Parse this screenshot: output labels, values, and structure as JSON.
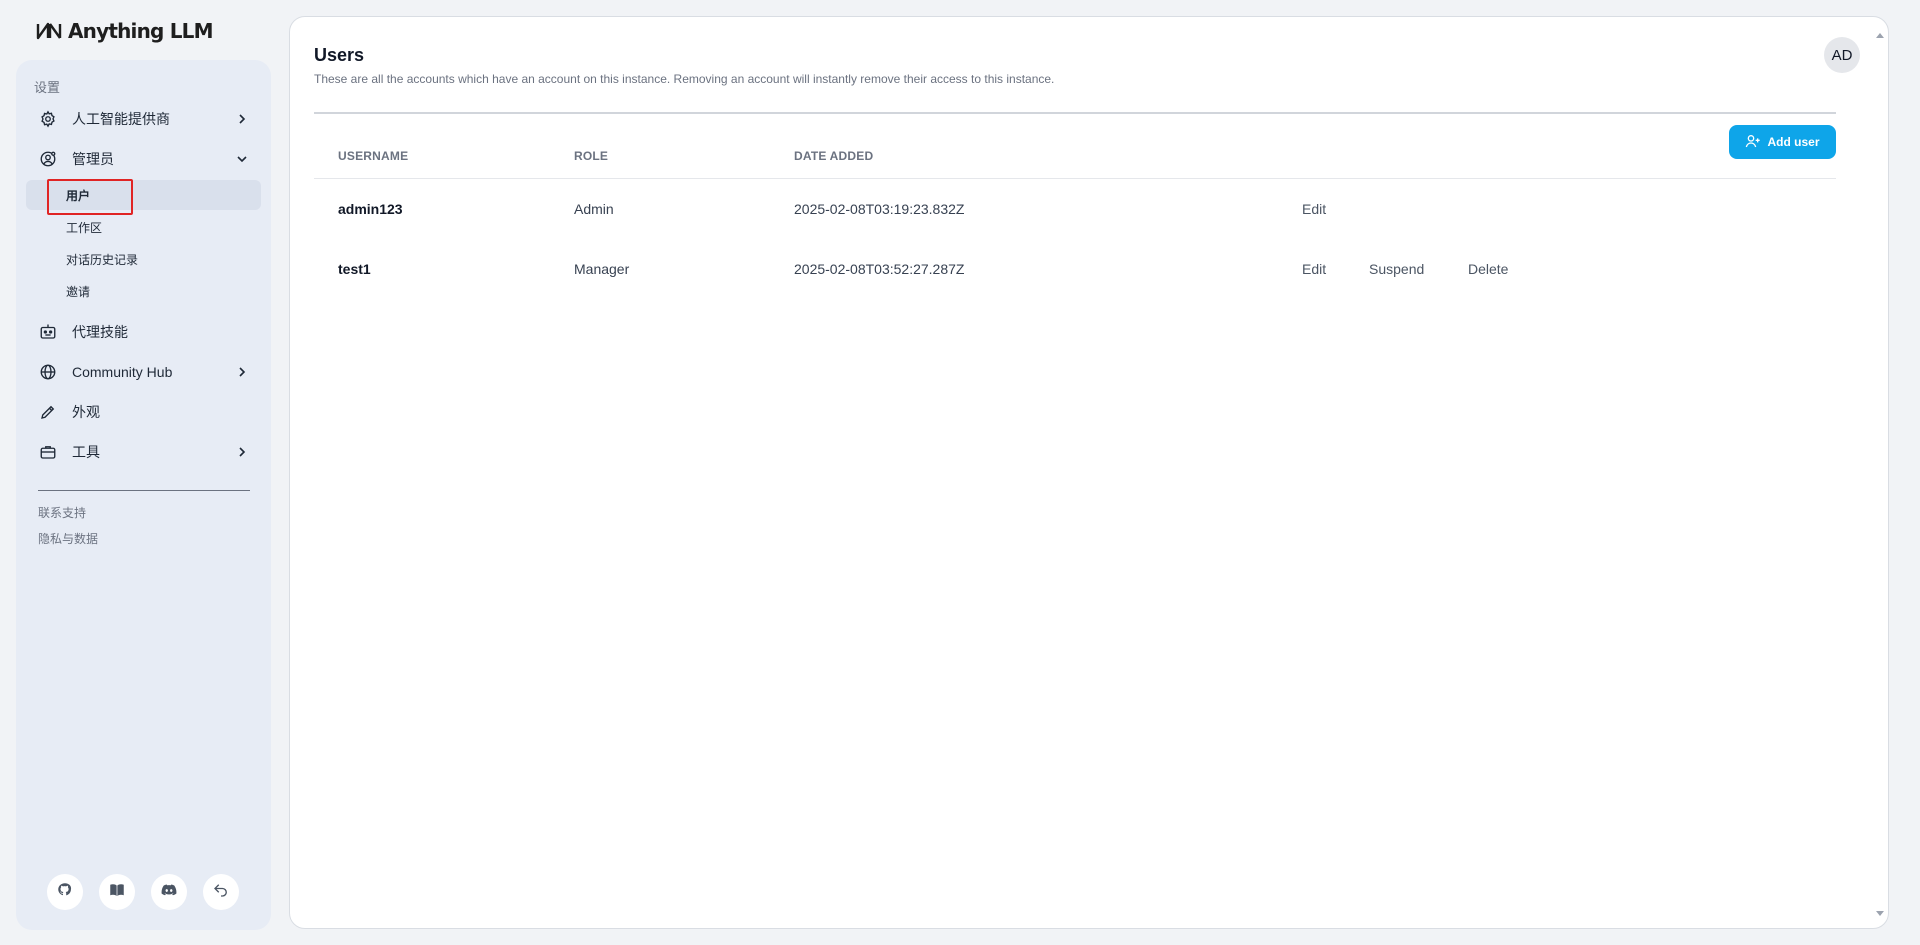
{
  "app": {
    "logo_text": "Anything LLM"
  },
  "sidebar": {
    "section_label": "设置",
    "items": [
      {
        "label": "人工智能提供商",
        "icon": "gear-icon",
        "chevron": "right"
      },
      {
        "label": "管理员",
        "icon": "user-gear-icon",
        "chevron": "down"
      },
      {
        "label": "代理技能",
        "icon": "robot-icon",
        "chevron": ""
      },
      {
        "label": "Community Hub",
        "icon": "globe-icon",
        "chevron": "right"
      },
      {
        "label": "外观",
        "icon": "pencil-icon",
        "chevron": ""
      },
      {
        "label": "工具",
        "icon": "briefcase-icon",
        "chevron": "right"
      }
    ],
    "admin_sub_items": [
      {
        "label": "用户",
        "active": true
      },
      {
        "label": "工作区"
      },
      {
        "label": "对话历史记录"
      },
      {
        "label": "邀请"
      }
    ],
    "footer_links": [
      "联系支持",
      "隐私与数据"
    ],
    "bottom_icons": [
      "github-icon",
      "book-icon",
      "discord-icon",
      "undo-icon"
    ]
  },
  "main": {
    "title": "Users",
    "description": "These are all the accounts which have an account on this instance. Removing an account will instantly remove their access to this instance.",
    "avatar_initials": "AD",
    "add_button_label": "Add user",
    "columns": [
      "USERNAME",
      "ROLE",
      "DATE ADDED"
    ],
    "rows": [
      {
        "username": "admin123",
        "role": "Admin",
        "date_added": "2025-02-08T03:19:23.832Z",
        "actions": [
          "Edit"
        ]
      },
      {
        "username": "test1",
        "role": "Manager",
        "date_added": "2025-02-08T03:52:27.287Z",
        "actions": [
          "Edit",
          "Suspend",
          "Delete"
        ]
      }
    ]
  },
  "colors": {
    "accent": "#0ea5e9",
    "sidebar_bg": "#e7ecf5",
    "highlight": "#e02424"
  }
}
